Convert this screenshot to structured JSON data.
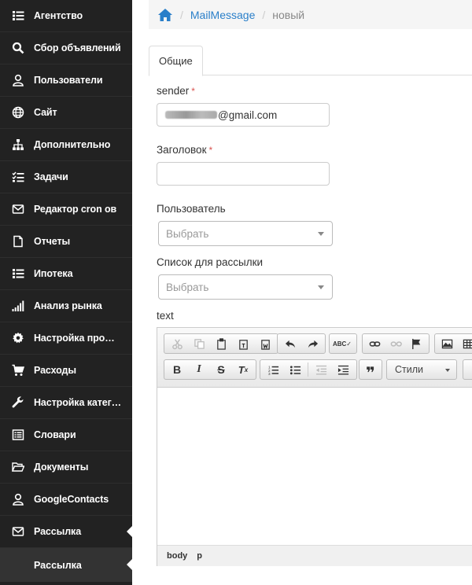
{
  "sidebar": {
    "items": [
      {
        "label": "Агентство",
        "icon": "list-icon"
      },
      {
        "label": "Сбор объявлений",
        "icon": "search-icon"
      },
      {
        "label": "Пользователи",
        "icon": "user-icon"
      },
      {
        "label": "Сайт",
        "icon": "globe-icon"
      },
      {
        "label": "Дополнительно",
        "icon": "sitemap-icon"
      },
      {
        "label": "Задачи",
        "icon": "tasks-icon"
      },
      {
        "label": "Редактор cron ов",
        "icon": "envelope-icon"
      },
      {
        "label": "Отчеты",
        "icon": "file-icon"
      },
      {
        "label": "Ипотека",
        "icon": "list-icon"
      },
      {
        "label": "Анализ рынка",
        "icon": "signal-icon"
      },
      {
        "label": "Настройка проф…",
        "icon": "gear-icon"
      },
      {
        "label": "Расходы",
        "icon": "cart-icon"
      },
      {
        "label": "Настройка катег…",
        "icon": "wrench-icon"
      },
      {
        "label": "Словари",
        "icon": "book-icon"
      },
      {
        "label": "Документы",
        "icon": "folder-open-icon"
      },
      {
        "label": "GoogleContacts",
        "icon": "user-icon"
      },
      {
        "label": "Рассылка",
        "icon": "envelope-icon"
      }
    ],
    "sub_item": "Рассылка"
  },
  "breadcrumb": {
    "link": "MailMessage",
    "current": "новый"
  },
  "tabs": [
    "Общие"
  ],
  "form": {
    "sender_label": "sender",
    "sender_value_suffix": "@gmail.com",
    "title_label": "Заголовок",
    "user_label": "Пользователь",
    "user_placeholder": "Выбрать",
    "list_label": "Список для рассылки",
    "list_placeholder": "Выбрать",
    "text_label": "text",
    "required_mark": "*"
  },
  "editor": {
    "styles_label": "Стили",
    "path": [
      "body",
      "p"
    ]
  }
}
